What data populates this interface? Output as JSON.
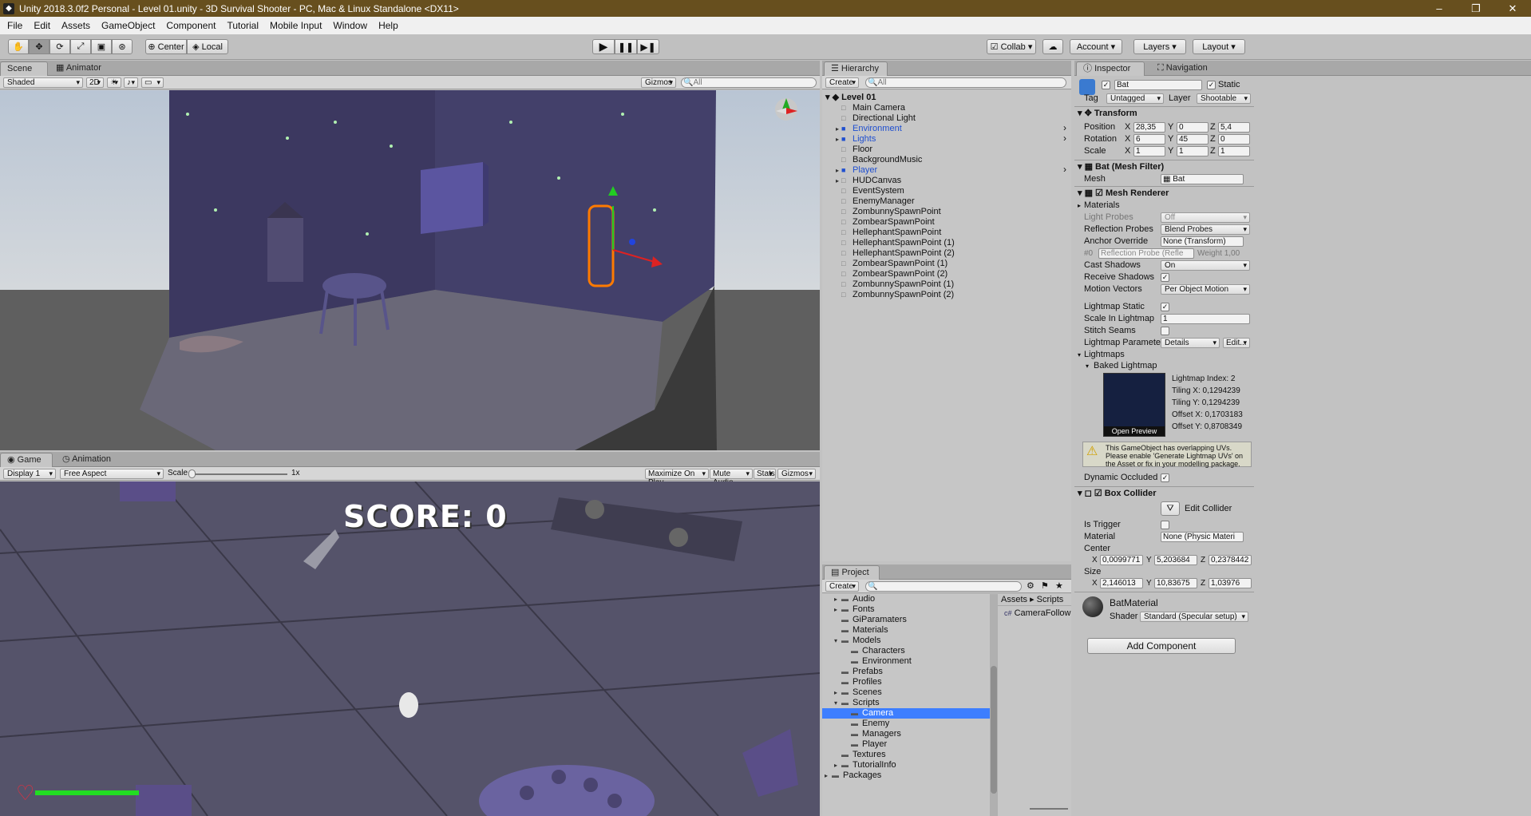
{
  "window": {
    "title": "Unity 2018.3.0f2 Personal - Level 01.unity - 3D Survival Shooter - PC, Mac & Linux Standalone <DX11>"
  },
  "menu": [
    "File",
    "Edit",
    "Assets",
    "GameObject",
    "Component",
    "Tutorial",
    "Mobile Input",
    "Window",
    "Help"
  ],
  "toolbar": {
    "center_label": "Center",
    "local_label": "Local",
    "collab_label": "Collab",
    "account_label": "Account",
    "layers_label": "Layers",
    "layout_label": "Layout"
  },
  "scene": {
    "tab_scene": "Scene",
    "tab_animator": "Animator",
    "shading": "Shaded",
    "mode_2d": "2D",
    "gizmos": "Gizmos",
    "search_placeholder": "All"
  },
  "game": {
    "tab_game": "Game",
    "tab_animation": "Animation",
    "display": "Display 1",
    "aspect": "Free Aspect",
    "scale_label": "Scale",
    "scale_value": "1x",
    "maximize": "Maximize On Play",
    "mute": "Mute Audio",
    "stats": "Stats",
    "gizmos": "Gizmos",
    "score_text": "SCORE: 0",
    "health_fraction": 1.0
  },
  "hierarchy": {
    "tab": "Hierarchy",
    "create": "Create",
    "search_placeholder": "All",
    "scene_name": "Level 01",
    "items": [
      {
        "label": "Main Camera",
        "prefab": false,
        "expandable": false
      },
      {
        "label": "Directional Light",
        "prefab": false,
        "expandable": false
      },
      {
        "label": "Environment",
        "prefab": true,
        "expandable": true
      },
      {
        "label": "Lights",
        "prefab": true,
        "expandable": true
      },
      {
        "label": "Floor",
        "prefab": false,
        "expandable": false
      },
      {
        "label": "BackgroundMusic",
        "prefab": false,
        "expandable": false
      },
      {
        "label": "Player",
        "prefab": true,
        "expandable": true
      },
      {
        "label": "HUDCanvas",
        "prefab": false,
        "expandable": true
      },
      {
        "label": "EventSystem",
        "prefab": false,
        "expandable": false
      },
      {
        "label": "EnemyManager",
        "prefab": false,
        "expandable": false
      },
      {
        "label": "ZombunnySpawnPoint",
        "prefab": false,
        "expandable": false
      },
      {
        "label": "ZombearSpawnPoint",
        "prefab": false,
        "expandable": false
      },
      {
        "label": "HellephantSpawnPoint",
        "prefab": false,
        "expandable": false
      },
      {
        "label": "HellephantSpawnPoint (1)",
        "prefab": false,
        "expandable": false
      },
      {
        "label": "HellephantSpawnPoint (2)",
        "prefab": false,
        "expandable": false
      },
      {
        "label": "ZombearSpawnPoint (1)",
        "prefab": false,
        "expandable": false
      },
      {
        "label": "ZombearSpawnPoint (2)",
        "prefab": false,
        "expandable": false
      },
      {
        "label": "ZombunnySpawnPoint (1)",
        "prefab": false,
        "expandable": false
      },
      {
        "label": "ZombunnySpawnPoint (2)",
        "prefab": false,
        "expandable": false
      }
    ]
  },
  "project": {
    "tab": "Project",
    "create": "Create",
    "breadcrumb": [
      "Assets",
      "Scripts"
    ],
    "folders": [
      {
        "label": "Audio",
        "depth": 0,
        "arrow": "right"
      },
      {
        "label": "Fonts",
        "depth": 0,
        "arrow": "right"
      },
      {
        "label": "GiParamaters",
        "depth": 0,
        "arrow": ""
      },
      {
        "label": "Materials",
        "depth": 0,
        "arrow": ""
      },
      {
        "label": "Models",
        "depth": 0,
        "arrow": "down"
      },
      {
        "label": "Characters",
        "depth": 1,
        "arrow": ""
      },
      {
        "label": "Environment",
        "depth": 1,
        "arrow": ""
      },
      {
        "label": "Prefabs",
        "depth": 0,
        "arrow": ""
      },
      {
        "label": "Profiles",
        "depth": 0,
        "arrow": ""
      },
      {
        "label": "Scenes",
        "depth": 0,
        "arrow": "right"
      },
      {
        "label": "Scripts",
        "depth": 0,
        "arrow": "down"
      },
      {
        "label": "Camera",
        "depth": 1,
        "arrow": "",
        "selected": true
      },
      {
        "label": "Enemy",
        "depth": 1,
        "arrow": ""
      },
      {
        "label": "Managers",
        "depth": 1,
        "arrow": ""
      },
      {
        "label": "Player",
        "depth": 1,
        "arrow": ""
      },
      {
        "label": "Textures",
        "depth": 0,
        "arrow": ""
      },
      {
        "label": "TutorialInfo",
        "depth": 0,
        "arrow": "right"
      },
      {
        "label": "Packages",
        "depth": -1,
        "arrow": "right"
      }
    ],
    "files": [
      {
        "label": "CameraFollow"
      }
    ]
  },
  "inspector": {
    "tab": "Inspector",
    "tab2": "Navigation",
    "object_name": "Bat",
    "static_label": "Static",
    "tag_label": "Tag",
    "tag": "Untagged",
    "layer_label": "Layer",
    "layer": "Shootable",
    "transform": {
      "title": "Transform",
      "position_label": "Position",
      "rotation_label": "Rotation",
      "scale_label": "Scale",
      "position": [
        "28,35",
        "0",
        "5,4"
      ],
      "rotation": [
        "6",
        "45",
        "0"
      ],
      "scale": [
        "1",
        "1",
        "1"
      ]
    },
    "mesh_filter": {
      "title": "Bat (Mesh Filter)",
      "mesh_label": "Mesh",
      "mesh": "Bat"
    },
    "mesh_renderer": {
      "title": "Mesh Renderer",
      "materials": "Materials",
      "light_probes_label": "Light Probes",
      "light_probes": "Off",
      "reflection_probes_label": "Reflection Probes",
      "reflection_probes": "Blend Probes",
      "anchor_override_label": "Anchor Override",
      "anchor_override": "None (Transform)",
      "probe_row_index": "#0",
      "probe_row": "Reflection Probe (Refle",
      "probe_weight": "Weight 1,00",
      "cast_shadows_label": "Cast Shadows",
      "cast_shadows": "On",
      "receive_shadows_label": "Receive Shadows",
      "motion_vectors_label": "Motion Vectors",
      "motion_vectors": "Per Object Motion",
      "lightmap_static_label": "Lightmap Static",
      "scale_lightmap_label": "Scale In Lightmap",
      "scale_lightmap": "1",
      "stitch_seams_label": "Stitch Seams",
      "lightmap_param_label": "Lightmap Parameter",
      "lightmap_param": "Details",
      "edit_label": "Edit...",
      "lightmaps_label": "Lightmaps",
      "baked_label": "Baked Lightmap",
      "lm_index": "Lightmap Index: 2",
      "tiling_x": "Tiling X: 0,1294239",
      "tiling_y": "Tiling Y: 0,1294239",
      "offset_x": "Offset X: 0,1703183",
      "offset_y": "Offset Y: 0,8708349",
      "open_preview": "Open Preview",
      "warning": "This GameObject has overlapping UVs. Please enable 'Generate Lightmap UVs' on the Asset or fix in your modelling package.",
      "dynamic_occluded_label": "Dynamic Occluded"
    },
    "box_collider": {
      "title": "Box Collider",
      "edit_collider": "Edit Collider",
      "is_trigger_label": "Is Trigger",
      "material_label": "Material",
      "material": "None (Physic Materi",
      "center_label": "Center",
      "center": [
        "0,0099771",
        "5,203684",
        "0,2378442"
      ],
      "size_label": "Size",
      "size": [
        "2,146013",
        "10,83675",
        "1,03976"
      ]
    },
    "material": {
      "name": "BatMaterial",
      "shader_label": "Shader",
      "shader": "Standard (Specular setup)"
    },
    "add_component": "Add Component"
  },
  "colors": {
    "title_bar": "#674f1e",
    "selection": "#3d7eff",
    "prefab_text": "#1f4fd0",
    "health": "#22dd22",
    "heart": "#e03040"
  }
}
